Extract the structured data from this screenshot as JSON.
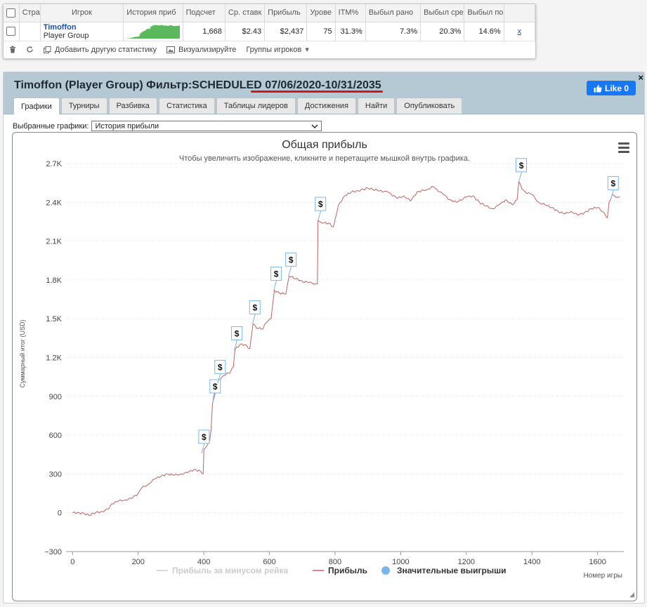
{
  "stats_table": {
    "headers": [
      "Стра",
      "Игрок",
      "История приб",
      "Подсчет",
      "Ср. ставк",
      "Прибыль",
      "Урове",
      "ITM%",
      "Выбыл рано",
      "Выбыл сре",
      "Выбыл по"
    ],
    "row": {
      "player_name": "Timoffon",
      "player_group": "Player Group",
      "count": "1,668",
      "avg_stake": "$2.43",
      "profit": "$2,437",
      "level": "75",
      "itm": "31.3%",
      "early_out": "7.3%",
      "mid_out": "20.3%",
      "late_out": "14.6%",
      "remove": "x",
      "sparkline_color": "#5cb85c"
    }
  },
  "toolbar": {
    "add_stats": "Добавить другую статистику",
    "visualize": "Визуализируйте",
    "groups": "Группы игроков"
  },
  "panel": {
    "title": "Timoffon (Player Group) Фильтр:SCHEDULED 07/06/2020-10/31/2035",
    "like": "Like 0",
    "close": "×",
    "tabs": [
      "Графики",
      "Турниры",
      "Разбивка",
      "Статистика",
      "Таблицы лидеров",
      "Достижения",
      "Найти",
      "Опубликовать"
    ],
    "active_tab": "Графики",
    "selector_label": "Выбранные графики:",
    "selector_value": "История прибыли"
  },
  "chart_data": {
    "type": "line",
    "title": "Общая прибыль",
    "subtitle": "Чтобы увеличить изображение, кликните и перетащите мышкой внутрь графика.",
    "ylabel": "Суммарный итог (USD)",
    "xlabel": "Номер игры",
    "xlim": [
      -20,
      1680
    ],
    "ylim": [
      -300,
      2700
    ],
    "x_ticks": [
      0,
      200,
      400,
      600,
      800,
      1000,
      1200,
      1400,
      1600
    ],
    "y_ticks": [
      -300,
      0,
      300,
      600,
      900,
      1200,
      1500,
      1800,
      2100,
      2400,
      2700
    ],
    "y_tick_labels": [
      "−300",
      "0",
      "300",
      "600",
      "900",
      "1.2K",
      "1.5K",
      "1.8K",
      "2.1K",
      "2.4K",
      "2.7K"
    ],
    "legend": [
      {
        "name": "Прибыль за минусом рейка",
        "color": "#cccccc",
        "marker": "line",
        "visible": false
      },
      {
        "name": "Прибыль",
        "color": "#c06060",
        "marker": "line",
        "visible": true
      },
      {
        "name": "Значительные выигрыши",
        "color": "#7cb5ec",
        "marker": "dot",
        "visible": true
      }
    ],
    "legend_position": "bottom-center",
    "grid": "horizontal-dotted",
    "series": [
      {
        "name": "Прибыль",
        "color": "#c06060",
        "points": [
          [
            0,
            0
          ],
          [
            20,
            0
          ],
          [
            35,
            -5
          ],
          [
            50,
            -20
          ],
          [
            70,
            0
          ],
          [
            90,
            10
          ],
          [
            110,
            30
          ],
          [
            120,
            70
          ],
          [
            140,
            90
          ],
          [
            160,
            100
          ],
          [
            180,
            110
          ],
          [
            200,
            150
          ],
          [
            210,
            190
          ],
          [
            230,
            220
          ],
          [
            250,
            260
          ],
          [
            270,
            285
          ],
          [
            290,
            300
          ],
          [
            310,
            290
          ],
          [
            330,
            300
          ],
          [
            350,
            310
          ],
          [
            370,
            335
          ],
          [
            390,
            320
          ],
          [
            398,
            300
          ],
          [
            400,
            490
          ],
          [
            410,
            520
          ],
          [
            418,
            560
          ],
          [
            422,
            640
          ],
          [
            426,
            830
          ],
          [
            430,
            900
          ],
          [
            440,
            990
          ],
          [
            450,
            1030
          ],
          [
            460,
            1060
          ],
          [
            470,
            1080
          ],
          [
            480,
            1080
          ],
          [
            490,
            1130
          ],
          [
            495,
            1260
          ],
          [
            510,
            1300
          ],
          [
            525,
            1300
          ],
          [
            540,
            1270
          ],
          [
            550,
            1460
          ],
          [
            560,
            1430
          ],
          [
            580,
            1420
          ],
          [
            590,
            1470
          ],
          [
            605,
            1500
          ],
          [
            615,
            1720
          ],
          [
            630,
            1700
          ],
          [
            650,
            1690
          ],
          [
            660,
            1830
          ],
          [
            680,
            1810
          ],
          [
            700,
            1790
          ],
          [
            720,
            1780
          ],
          [
            740,
            1770
          ],
          [
            746,
            1770
          ],
          [
            748,
            2260
          ],
          [
            760,
            2240
          ],
          [
            780,
            2240
          ],
          [
            795,
            2210
          ],
          [
            810,
            2380
          ],
          [
            830,
            2450
          ],
          [
            850,
            2480
          ],
          [
            870,
            2490
          ],
          [
            900,
            2510
          ],
          [
            930,
            2490
          ],
          [
            960,
            2480
          ],
          [
            990,
            2430
          ],
          [
            1010,
            2450
          ],
          [
            1030,
            2410
          ],
          [
            1050,
            2480
          ],
          [
            1080,
            2500
          ],
          [
            1100,
            2520
          ],
          [
            1110,
            2500
          ],
          [
            1130,
            2460
          ],
          [
            1150,
            2420
          ],
          [
            1170,
            2400
          ],
          [
            1200,
            2440
          ],
          [
            1220,
            2450
          ],
          [
            1240,
            2400
          ],
          [
            1260,
            2370
          ],
          [
            1280,
            2350
          ],
          [
            1300,
            2380
          ],
          [
            1320,
            2420
          ],
          [
            1340,
            2380
          ],
          [
            1355,
            2420
          ],
          [
            1360,
            2560
          ],
          [
            1370,
            2500
          ],
          [
            1380,
            2480
          ],
          [
            1400,
            2460
          ],
          [
            1420,
            2400
          ],
          [
            1440,
            2380
          ],
          [
            1460,
            2360
          ],
          [
            1480,
            2330
          ],
          [
            1500,
            2310
          ],
          [
            1520,
            2330
          ],
          [
            1540,
            2300
          ],
          [
            1560,
            2320
          ],
          [
            1580,
            2350
          ],
          [
            1600,
            2360
          ],
          [
            1620,
            2320
          ],
          [
            1630,
            2280
          ],
          [
            1635,
            2400
          ],
          [
            1645,
            2460
          ],
          [
            1655,
            2440
          ],
          [
            1668,
            2437
          ]
        ]
      }
    ],
    "big_wins": [
      {
        "x": 393,
        "y": 460,
        "label": "$"
      },
      {
        "x": 427,
        "y": 850,
        "label": "$"
      },
      {
        "x": 442,
        "y": 1000,
        "label": "$"
      },
      {
        "x": 493,
        "y": 1260,
        "label": "$"
      },
      {
        "x": 548,
        "y": 1460,
        "label": "$"
      },
      {
        "x": 613,
        "y": 1720,
        "label": "$"
      },
      {
        "x": 658,
        "y": 1830,
        "label": "$"
      },
      {
        "x": 748,
        "y": 2260,
        "label": "$"
      },
      {
        "x": 1360,
        "y": 2560,
        "label": "$"
      },
      {
        "x": 1640,
        "y": 2420,
        "label": "$"
      }
    ]
  }
}
